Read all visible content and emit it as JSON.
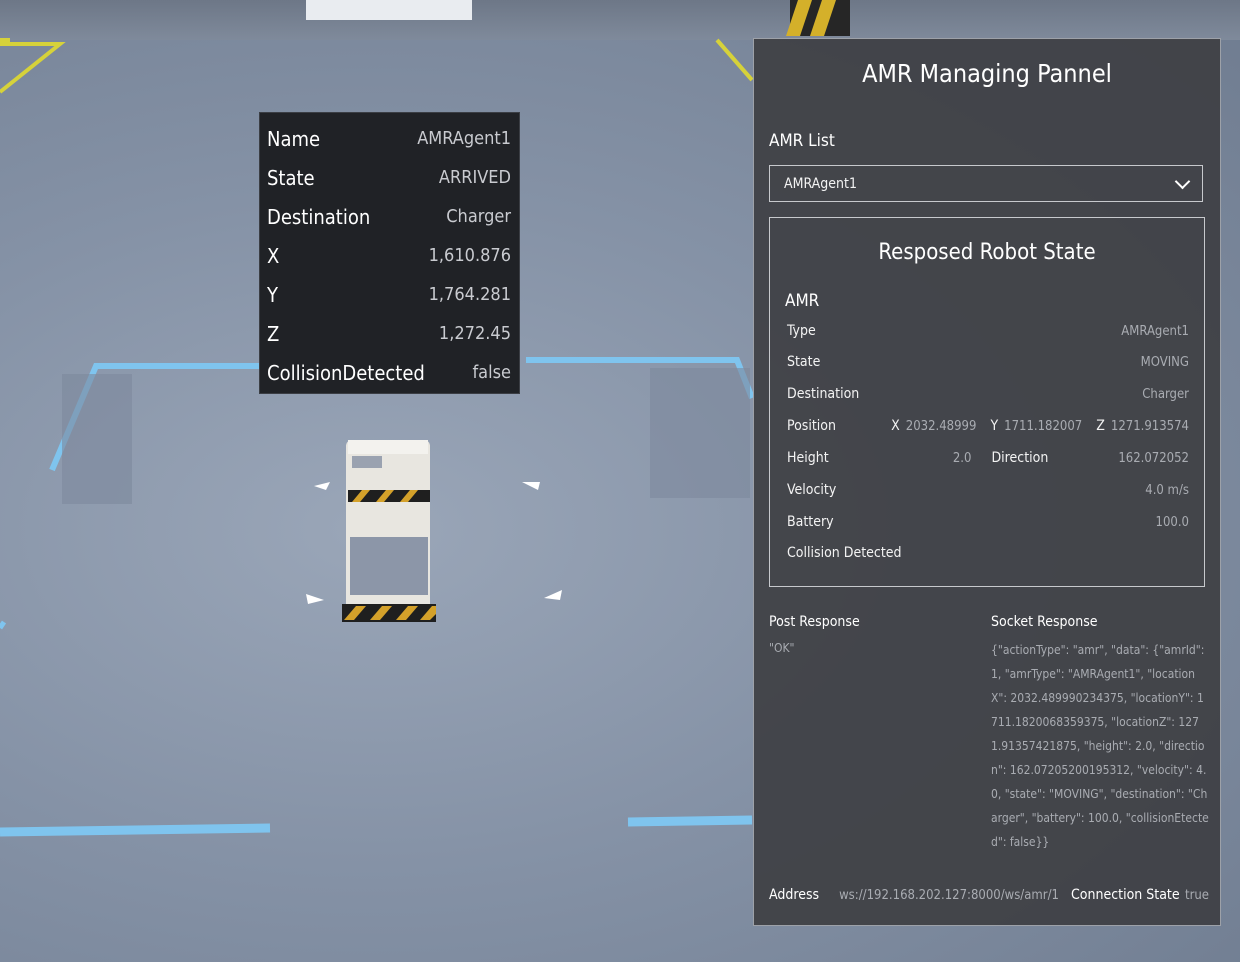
{
  "agent_info": {
    "rows": [
      {
        "key": "Name",
        "value": "AMRAgent1"
      },
      {
        "key": "State",
        "value": "ARRIVED"
      },
      {
        "key": "Destination",
        "value": "Charger"
      },
      {
        "key": "X",
        "value": "1,610.876"
      },
      {
        "key": "Y",
        "value": "1,764.281"
      },
      {
        "key": "Z",
        "value": "1,272.45"
      },
      {
        "key": "CollisionDetected",
        "value": "false"
      }
    ]
  },
  "panel": {
    "title": "AMR Managing Pannel",
    "amr_list_label": "AMR List",
    "selected_amr": "AMRAgent1",
    "state_title": "Resposed Robot State",
    "amr_header": "AMR",
    "type_label": "Type",
    "type_value": "AMRAgent1",
    "state_label": "State",
    "state_value": "MOVING",
    "destination_label": "Destination",
    "destination_value": "Charger",
    "position_label": "Position",
    "position": {
      "x_label": "X",
      "x": "2032.48999",
      "y_label": "Y",
      "y": "1711.182007",
      "z_label": "Z",
      "z": "1271.913574"
    },
    "height_label": "Height",
    "height_value": "2.0",
    "direction_label": "Direction",
    "direction_value": "162.072052",
    "velocity_label": "Velocity",
    "velocity_value": "4.0 m/s",
    "battery_label": "Battery",
    "battery_value": "100.0",
    "collision_label": "Collision Detected",
    "collision_value": "",
    "post_response_label": "Post Response",
    "post_response_value": "\"OK\"",
    "socket_response_label": "Socket Response",
    "socket_response_value": "{\"actionType\": \"amr\", \"data\": {\"amrId\": 1, \"amrType\": \"AMRAgent1\", \"locationX\": 2032.489990234375, \"locationY\": 1711.1820068359375, \"locationZ\": 1271.91357421875, \"height\": 2.0, \"direction\": 162.07205200195312, \"velocity\": 4.0, \"state\": \"MOVING\", \"destination\": \"Charger\", \"battery\": 100.0, \"collisionEtected\": false}}",
    "address_label": "Address",
    "address_value": "ws://192.168.202.127:8000/ws/amr/1",
    "connection_label": "Connection State",
    "connection_value": "true"
  }
}
